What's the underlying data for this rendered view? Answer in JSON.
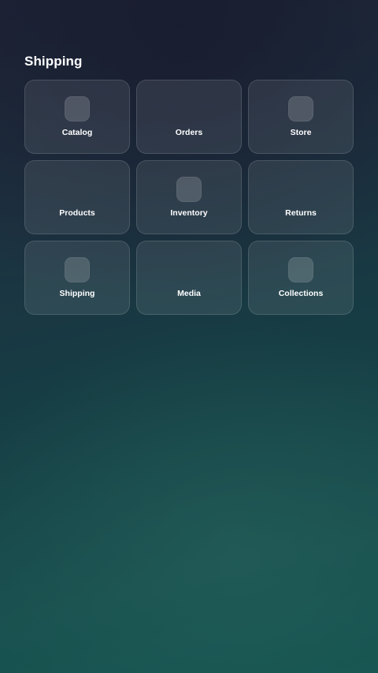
{
  "page": {
    "title": "Shipping"
  },
  "tiles": [
    {
      "label": "Catalog",
      "icon": "rounded-square-icon",
      "has_icon": true
    },
    {
      "label": "Orders",
      "has_icon": false
    },
    {
      "label": "Store",
      "icon": "rounded-square-icon",
      "has_icon": true
    },
    {
      "label": "Products",
      "has_icon": false
    },
    {
      "label": "Inventory",
      "icon": "rounded-square-icon",
      "has_icon": true
    },
    {
      "label": "Returns",
      "has_icon": false
    },
    {
      "label": "Shipping",
      "icon": "rounded-square-icon",
      "has_icon": true
    },
    {
      "label": "Media",
      "has_icon": false
    },
    {
      "label": "Collections",
      "icon": "rounded-square-icon",
      "has_icon": true
    }
  ],
  "colors": {
    "background_top": "#1e2437",
    "background_bottom": "#145450",
    "text": "#ffffff"
  }
}
